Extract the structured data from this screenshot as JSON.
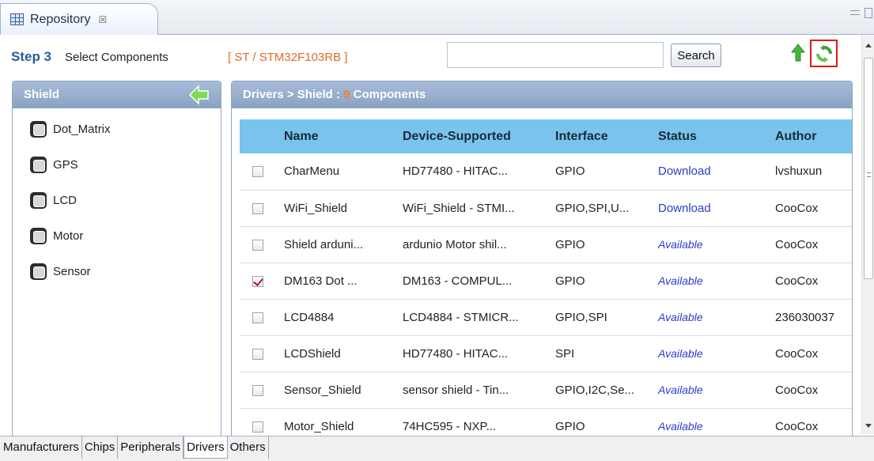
{
  "view": {
    "title": "Repository",
    "close_glyph": "☒"
  },
  "stepbar": {
    "step_label": "Step 3",
    "step_text": "Select Components",
    "chip_path": "[ ST / STM32F103RB ]",
    "search_value": "",
    "search_placeholder": "",
    "search_button": "Search"
  },
  "left_panel": {
    "title": "Shield",
    "items": [
      "Dot_Matrix",
      "GPS",
      "LCD",
      "Motor",
      "Sensor"
    ]
  },
  "right_panel": {
    "title_prefix": "Drivers > Shield : ",
    "count": "9",
    "title_suffix": " Components",
    "columns": [
      "Name",
      "Device-Supported",
      "Interface",
      "Status",
      "Author"
    ],
    "rows": [
      {
        "checked": false,
        "name": "CharMenu",
        "device": "HD77480 - HITAC...",
        "interface": "GPIO",
        "status": "Download",
        "author": "lvshuxun"
      },
      {
        "checked": false,
        "name": "WiFi_Shield",
        "device": "WiFi_Shield - STMI...",
        "interface": "GPIO,SPI,U...",
        "status": "Download",
        "author": "CooCox"
      },
      {
        "checked": false,
        "name": "Shield arduni...",
        "device": "ardunio Motor shil...",
        "interface": "GPIO",
        "status": "Available",
        "author": "CooCox"
      },
      {
        "checked": true,
        "name": "DM163 Dot ...",
        "device": "DM163 - COMPUL...",
        "interface": "GPIO",
        "status": "Available",
        "author": "CooCox"
      },
      {
        "checked": false,
        "name": "LCD4884",
        "device": "LCD4884 - STMICR...",
        "interface": "GPIO,SPI",
        "status": "Available",
        "author": "236030037"
      },
      {
        "checked": false,
        "name": "LCDShield",
        "device": "HD77480 - HITAC...",
        "interface": "SPI",
        "status": "Available",
        "author": "CooCox"
      },
      {
        "checked": false,
        "name": "Sensor_Shield",
        "device": "sensor shield - Tin...",
        "interface": "GPIO,I2C,Se...",
        "status": "Available",
        "author": "CooCox"
      },
      {
        "checked": false,
        "name": "Motor_Shield",
        "device": "74HC595 - NXP...",
        "interface": "GPIO",
        "status": "Available",
        "author": "CooCox"
      }
    ]
  },
  "bottom_tabs": [
    "Manufacturers",
    "Chips",
    "Peripherals",
    "Drivers",
    "Others"
  ],
  "bottom_active": "Drivers",
  "colors": {
    "accent": "#2d5a9a",
    "chip_path": "#e36a2c",
    "count": "#f07f2e",
    "table_header": "#78c4ec",
    "panel_header": "#8aa2c3",
    "highlight_box": "#e01818"
  }
}
